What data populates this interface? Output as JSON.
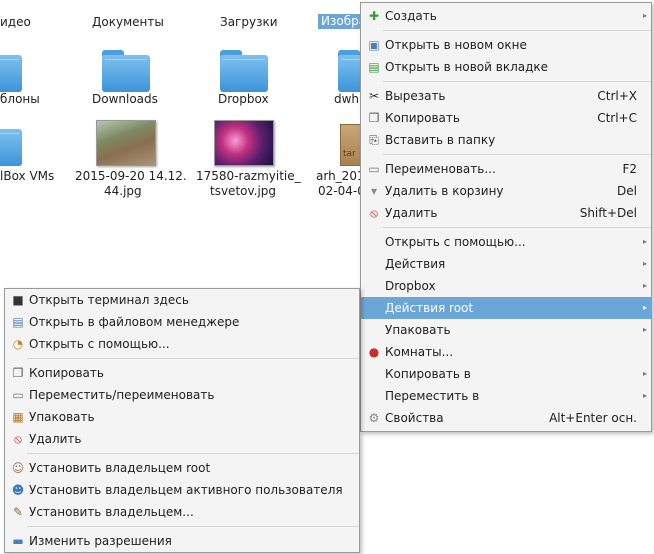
{
  "file_manager": {
    "top_labels": [
      "идео",
      "Документы",
      "Загрузки",
      "Изобра"
    ],
    "row2_labels": [
      "блоны",
      "Downloads",
      "Dropbox",
      "dwh"
    ],
    "row3": {
      "label_a": "lBox VMs",
      "img1_line1": "2015-09-20 14.12.",
      "img1_line2": "44.jpg",
      "img2_line1": "17580-razmyitie_",
      "img2_line2": "tsvetov.jpg",
      "arch_line1": "arh_201",
      "arch_line2": "02-04-0",
      "arch_badge": "tar"
    }
  },
  "context_menu": {
    "items": [
      {
        "label": "Создать",
        "icon": "new-file-icon",
        "shortcut": "",
        "submenu": true
      },
      {
        "sep": true
      },
      {
        "label": "Открыть в новом окне",
        "icon": "new-window-icon",
        "shortcut": "",
        "submenu": false
      },
      {
        "label": "Открыть в новой вкладке",
        "icon": "new-tab-icon",
        "shortcut": "",
        "submenu": false
      },
      {
        "sep": true
      },
      {
        "label": "Вырезать",
        "icon": "cut-icon",
        "shortcut": "Ctrl+X",
        "submenu": false
      },
      {
        "label": "Копировать",
        "icon": "copy-icon",
        "shortcut": "Ctrl+C",
        "submenu": false
      },
      {
        "label": "Вставить в папку",
        "icon": "paste-icon",
        "shortcut": "",
        "submenu": false
      },
      {
        "sep": true
      },
      {
        "label": "Переименовать...",
        "icon": "rename-icon",
        "shortcut": "F2",
        "submenu": false
      },
      {
        "label": "Удалить в корзину",
        "icon": "trash-icon",
        "shortcut": "Del",
        "submenu": false
      },
      {
        "label": "Удалить",
        "icon": "delete-icon",
        "shortcut": "Shift+Del",
        "submenu": false
      },
      {
        "sep": true
      },
      {
        "label": "Открыть с помощью...",
        "icon": "",
        "shortcut": "",
        "submenu": true
      },
      {
        "label": "Действия",
        "icon": "",
        "shortcut": "",
        "submenu": true
      },
      {
        "label": "Dropbox",
        "icon": "",
        "shortcut": "",
        "submenu": true
      },
      {
        "label": "Действия root",
        "icon": "",
        "shortcut": "",
        "submenu": true,
        "highlighted": true
      },
      {
        "label": "Упаковать",
        "icon": "",
        "shortcut": "",
        "submenu": true
      },
      {
        "label": "Комнаты...",
        "icon": "rooms-icon",
        "shortcut": "",
        "submenu": false
      },
      {
        "label": "Копировать в",
        "icon": "",
        "shortcut": "",
        "submenu": true
      },
      {
        "label": "Переместить в",
        "icon": "",
        "shortcut": "",
        "submenu": true
      },
      {
        "label": "Свойства",
        "icon": "properties-icon",
        "shortcut": "Alt+Enter осн.",
        "submenu": false
      }
    ]
  },
  "root_submenu": {
    "items": [
      {
        "label": "Открыть терминал здесь",
        "icon": "terminal-icon"
      },
      {
        "label": "Открыть в файловом менеджере",
        "icon": "file-manager-icon"
      },
      {
        "label": "Открыть с помощью...",
        "icon": "open-with-icon"
      },
      {
        "sep": true
      },
      {
        "label": "Копировать",
        "icon": "copy-icon"
      },
      {
        "label": "Переместить/переименовать",
        "icon": "rename-icon"
      },
      {
        "label": "Упаковать",
        "icon": "archive-icon"
      },
      {
        "label": "Удалить",
        "icon": "delete-icon"
      },
      {
        "sep": true
      },
      {
        "label": "Установить владельцем root",
        "icon": "owner-root-icon"
      },
      {
        "label": "Установить владельцем активного пользователя",
        "icon": "owner-user-icon"
      },
      {
        "label": "Установить владельцем...",
        "icon": "owner-custom-icon"
      },
      {
        "sep": true
      },
      {
        "label": "Изменить разрешения",
        "icon": "permissions-icon"
      }
    ]
  }
}
